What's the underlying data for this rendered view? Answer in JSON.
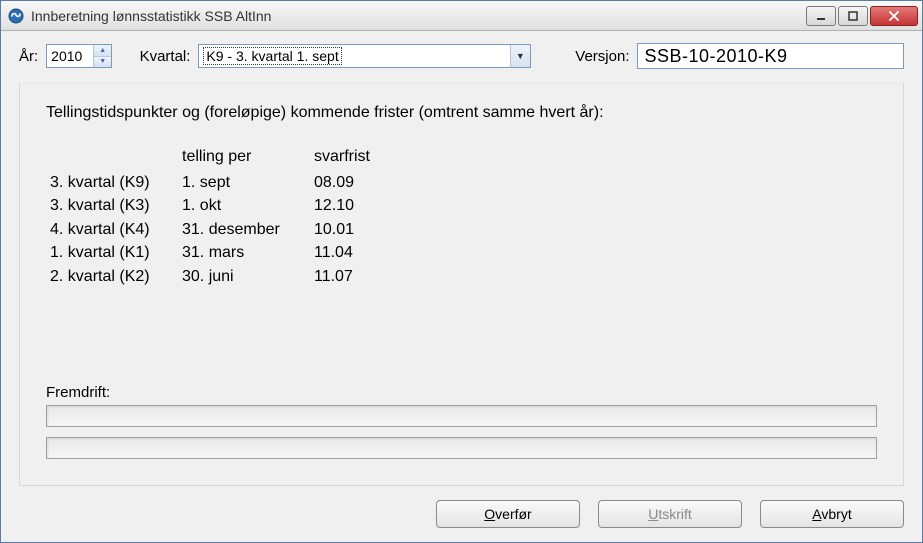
{
  "window": {
    "title": "Innberetning lønnsstatistikk SSB AltInn"
  },
  "form": {
    "year_label": "År:",
    "year_value": "2010",
    "kvartal_label": "Kvartal:",
    "kvartal_selected": "K9 - 3. kvartal 1. sept",
    "version_label": "Versjon:",
    "version_value": "SSB-10-2010-K9"
  },
  "info": {
    "heading": "Tellingstidspunkter og (foreløpige) kommende frister (omtrent samme hvert år):",
    "col_telling": "telling per",
    "col_svarfrist": "svarfrist",
    "rows": [
      {
        "kv": "3. kvartal (K9)",
        "telling": "1. sept",
        "frist": "08.09"
      },
      {
        "kv": "3. kvartal (K3)",
        "telling": "1. okt",
        "frist": "12.10"
      },
      {
        "kv": "4. kvartal (K4)",
        "telling": "31. desember",
        "frist": "10.01"
      },
      {
        "kv": "1. kvartal (K1)",
        "telling": "31. mars",
        "frist": "11.04"
      },
      {
        "kv": "2. kvartal (K2)",
        "telling": "30. juni",
        "frist": "11.07"
      }
    ]
  },
  "progress": {
    "label": "Fremdrift:"
  },
  "buttons": {
    "overfor_pre": "O",
    "overfor_rest": "verfør",
    "utskrift_pre": "U",
    "utskrift_rest": "tskrift",
    "avbryt_pre": "A",
    "avbryt_rest": "vbryt"
  }
}
